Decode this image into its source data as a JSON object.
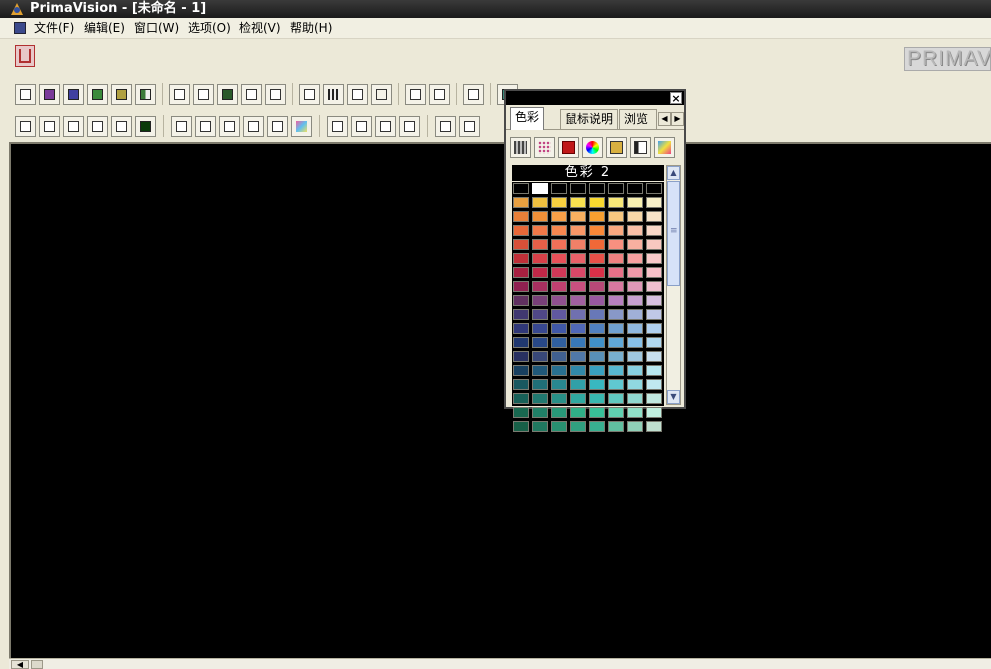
{
  "window": {
    "title": "PrimaVision - [未命名 - 1]"
  },
  "menu": [
    {
      "label": "文件(F)"
    },
    {
      "label": "编辑(E)"
    },
    {
      "label": "窗口(W)"
    },
    {
      "label": "选项(O)"
    },
    {
      "label": "检视(V)"
    },
    {
      "label": "帮助(H)"
    }
  ],
  "brand_text": "PRIMAV",
  "palette": {
    "tabs": [
      {
        "label": "色彩"
      },
      {
        "label": "鼠标说明"
      },
      {
        "label": "浏览"
      }
    ],
    "header": "色彩  2",
    "close_symbol": "×"
  },
  "colors": {
    "canvas": "#000000",
    "title_bar": "#1a1a1a",
    "accent": "#3c4a8c"
  },
  "swatches": [
    [
      "#000000",
      "#ffffff",
      "#000000",
      "#000000",
      "#000000",
      "#000000",
      "#000000",
      "#000000"
    ],
    [
      "#e8a040",
      "#f0c040",
      "#f8d040",
      "#f8e050",
      "#f8d830",
      "#f8e878",
      "#f8f0b0",
      "#f8f0c8"
    ],
    [
      "#e88038",
      "#f09038",
      "#f8a048",
      "#f8b060",
      "#f8a030",
      "#f8c880",
      "#f8d8a8",
      "#f8e4c8"
    ],
    [
      "#e86838",
      "#f07848",
      "#f88850",
      "#f89868",
      "#f88838",
      "#f8a880",
      "#f8c0a8",
      "#f8d8c8"
    ],
    [
      "#d85038",
      "#e86048",
      "#f07058",
      "#f08068",
      "#f06838",
      "#f89080",
      "#f8b0a0",
      "#f8c8c0"
    ],
    [
      "#c03038",
      "#d84048",
      "#e85058",
      "#e86068",
      "#e85048",
      "#f08080",
      "#f8a0a0",
      "#f8c8c8"
    ],
    [
      "#a82040",
      "#c02848",
      "#d03858",
      "#d84868",
      "#d83048",
      "#e87088",
      "#f098a8",
      "#f8c0c8"
    ],
    [
      "#902050",
      "#a83060",
      "#c04070",
      "#c85080",
      "#b84878",
      "#d878a0",
      "#e098b8",
      "#f0c0d0"
    ],
    [
      "#603060",
      "#784078",
      "#905090",
      "#a060a0",
      "#9858a0",
      "#b880c0",
      "#c8a0d0",
      "#d8c0e0"
    ],
    [
      "#403870",
      "#504888",
      "#6058a0",
      "#7070b0",
      "#6878b8",
      "#8898c8",
      "#a0b0d8",
      "#c0c8e8"
    ],
    [
      "#303878",
      "#384890",
      "#4058a8",
      "#5068b8",
      "#5080c0",
      "#70a0d0",
      "#90b8e0",
      "#b0d0f0"
    ],
    [
      "#203870",
      "#284888",
      "#3060a0",
      "#3878b8",
      "#4090c8",
      "#60a8d8",
      "#88c0e8",
      "#b0d8f0"
    ],
    [
      "#283060",
      "#384878",
      "#406090",
      "#5078a8",
      "#5890b8",
      "#78b0d0",
      "#a0c8e0",
      "#c8e0f0"
    ],
    [
      "#184060",
      "#205878",
      "#287090",
      "#3088a8",
      "#38a0c0",
      "#58b8d0",
      "#88d0e0",
      "#b8e8f0"
    ],
    [
      "#185860",
      "#207078",
      "#288890",
      "#30a0a8",
      "#38b8c0",
      "#60c8d0",
      "#90d8e0",
      "#c0e8f0"
    ],
    [
      "#186058",
      "#207870",
      "#289088",
      "#30a8a0",
      "#38b8b0",
      "#60c8c0",
      "#90d8d0",
      "#c0e8e0"
    ],
    [
      "#186850",
      "#208068",
      "#289878",
      "#30b088",
      "#38c098",
      "#60d0b0",
      "#90e0c8",
      "#c0f0e0"
    ],
    [
      "#186048",
      "#207860",
      "#289070",
      "#30a080",
      "#38b090",
      "#60c0a0",
      "#90d0b8",
      "#c0e0d0"
    ]
  ],
  "toolbar1_groups": [
    [
      "pointer-edit-icon",
      "pattern-a-icon",
      "pattern-b-icon",
      "tree-icon",
      "frame-icon",
      "split-icon"
    ],
    [
      "folder-open-icon",
      "folder-edit-icon",
      "folder-dark-icon",
      "document-info-icon",
      "document-list-icon"
    ],
    [
      "crop-corner-icon",
      "grid-icon",
      "pencil-line-icon",
      "blank-rect-icon"
    ],
    [
      "select-box-icon",
      "lasso-icon"
    ],
    [
      "move-arrows-icon"
    ],
    [
      "green-tool-icon"
    ]
  ],
  "toolbar2_groups": [
    [
      "corner-arrow-1-icon",
      "corner-arrow-2-icon",
      "corner-arrow-3-icon",
      "corner-arrow-4-icon",
      "dot-icon",
      "fill-square-icon"
    ],
    [
      "brush-icon",
      "paint-bucket-icon",
      "stamp-icon",
      "pen-icon",
      "mask-icon",
      "gradient-icon"
    ],
    [
      "layers-icon",
      "stack-icon",
      "print-icon",
      "flatten-icon"
    ],
    [
      "undo-icon",
      "redo-icon"
    ]
  ],
  "palette_tools": [
    "grid-pattern-icon",
    "dots-pattern-icon",
    "red-swatch-icon",
    "colorwheel-icon",
    "book-icon",
    "spectrum-icon",
    "gradient-swatch-icon"
  ]
}
